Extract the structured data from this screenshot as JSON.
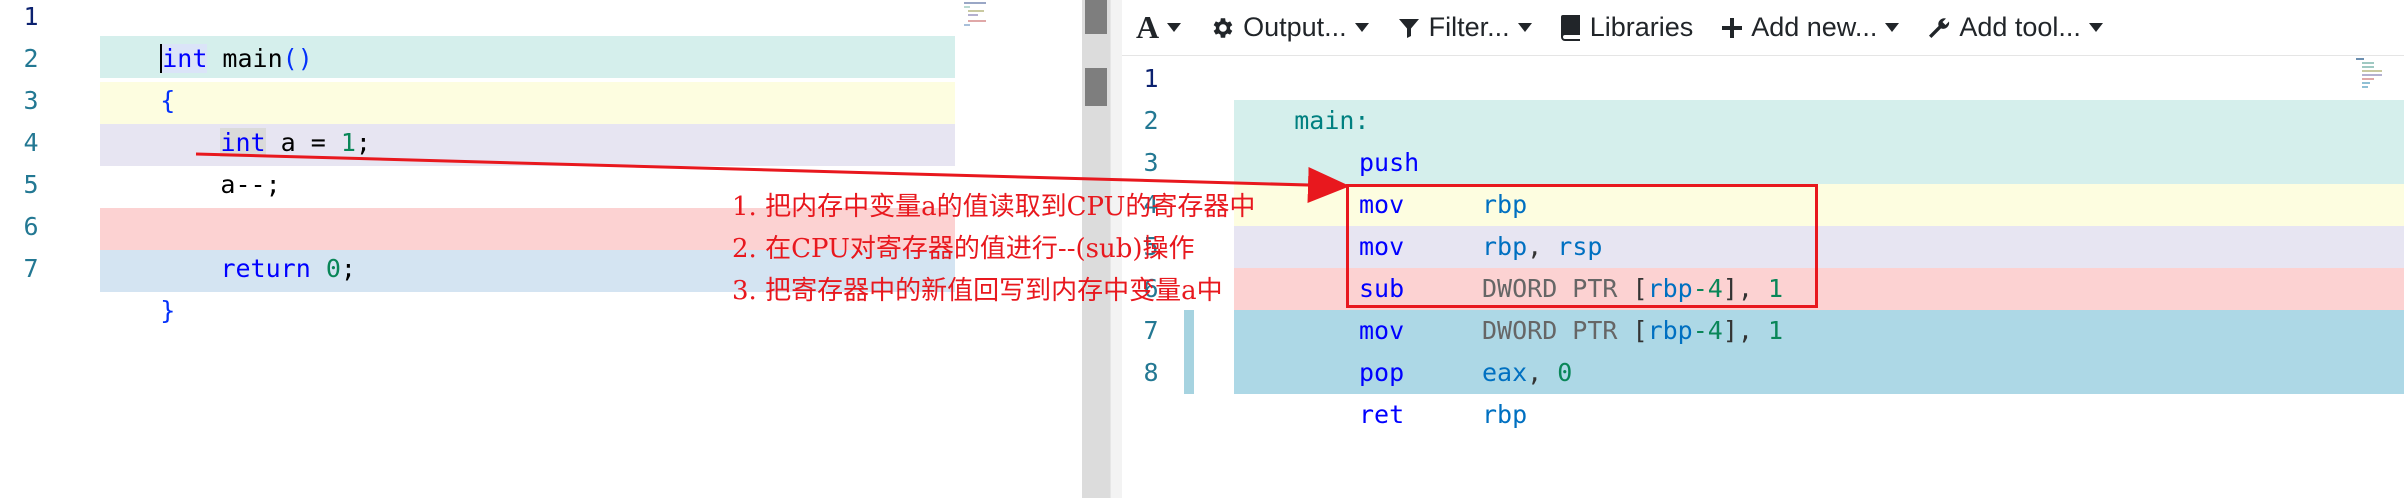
{
  "source": {
    "line_numbers": [
      "1",
      "2",
      "3",
      "4",
      "5",
      "6",
      "7"
    ],
    "lines": [
      {
        "t1": "int",
        "t2": " main",
        "t3": "()",
        "t4": ""
      },
      {
        "t1": "{",
        "t2": "",
        "t3": "",
        "t4": ""
      },
      {
        "t1": "    ",
        "t2": "int",
        "t3": " a = ",
        "t4": "1",
        "t5": ";"
      },
      {
        "t1": "    a--;",
        "t2": "",
        "t3": "",
        "t4": ""
      },
      {
        "t1": "",
        "t2": "",
        "t3": "",
        "t4": ""
      },
      {
        "t1": "    ",
        "t2": "return",
        "t3": " ",
        "t4": "0",
        "t5": ";"
      },
      {
        "t1": "}",
        "t2": "",
        "t3": "",
        "t4": ""
      }
    ]
  },
  "toolbar": {
    "font_icon": "A",
    "output_label": "Output...",
    "filter_label": "Filter...",
    "libraries_label": "Libraries",
    "add_new_label": "Add new...",
    "add_tool_label": "Add tool..."
  },
  "asm": {
    "line_numbers": [
      "1",
      "2",
      "3",
      "4",
      "5",
      "6",
      "7",
      "8"
    ],
    "label": "main:",
    "rows": [
      {
        "op": "push",
        "a": "rbp"
      },
      {
        "op": "mov",
        "a": "rbp",
        "b": ", ",
        "c": "rsp"
      },
      {
        "op": "mov",
        "a": "DWORD PTR ",
        "b": "[",
        "c": "rbp",
        "d": "-4",
        "e": "], ",
        "f": "1"
      },
      {
        "op": "sub",
        "a": "DWORD PTR ",
        "b": "[",
        "c": "rbp",
        "d": "-4",
        "e": "], ",
        "f": "1"
      },
      {
        "op": "mov",
        "a": "eax",
        "b": ", ",
        "c": "0"
      },
      {
        "op": "pop",
        "a": "rbp"
      },
      {
        "op": "ret"
      }
    ]
  },
  "notes": [
    "1. 把内存中变量a的值读取到CPU的寄存器中",
    "2. 在CPU对寄存器的值进行--(sub)操作",
    "3. 把寄存器中的新值回写到内存中变量a中"
  ],
  "colors": {
    "line2_bg": "#d5efec",
    "line3_bg": "#fdfde0",
    "line4_bg": "#e7e5f2",
    "line6_bg": "#fcd2d2",
    "line7_bg": "#d4e4f2",
    "asm_blue_bg": "#add8e6",
    "annotation_red": "#e8181e"
  },
  "icons": [
    "font-icon",
    "gear-icon",
    "filter-icon",
    "book-icon",
    "plus-icon",
    "wrench-icon"
  ]
}
